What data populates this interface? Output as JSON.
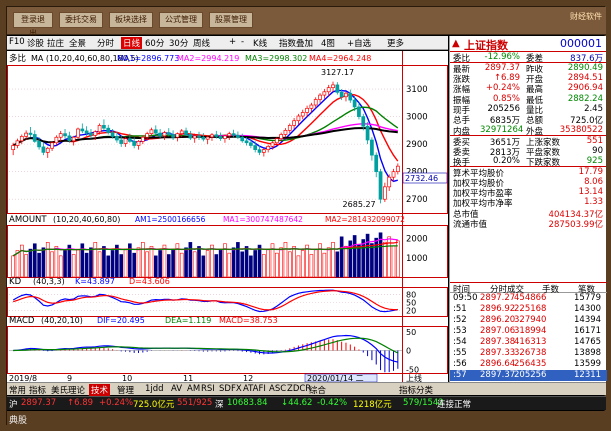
{
  "toolbar": {
    "buttons": [
      "登录退出",
      "委托交易",
      "板块选择",
      "公式管理",
      "股票管理"
    ],
    "brand": "财经软件"
  },
  "chart_menu": {
    "items": [
      "F10",
      "诊股",
      "拉庄",
      "全景",
      "分时",
      "日线",
      "60分",
      "30分",
      "周线",
      "+",
      "-",
      "K线",
      "指数叠加",
      "4图",
      "+自选",
      "更多"
    ],
    "active": "日线"
  },
  "chart_data": [
    {
      "type": "candlestick",
      "name": "price",
      "header_label": "多比",
      "ma_params": "MA (10,20,40,60,80,180,5)",
      "ma_labels": [
        {
          "text": "MA1=2896.773",
          "color": "#0000ff"
        },
        {
          "text": "MA2=2994.219",
          "color": "#ff00ff"
        },
        {
          "text": "MA3=2998.302",
          "color": "#008000"
        },
        {
          "text": "MA4=2964.248",
          "color": "#ff0000"
        }
      ],
      "ylim": [
        2650,
        3180
      ],
      "y_ticks": [
        2700,
        2800,
        2900,
        3000,
        3100
      ],
      "y_tick_labels": [
        "2700",
        "2800",
        "2900",
        "3000",
        "3100"
      ],
      "high_label": "3127.17",
      "low_label": "2685.27",
      "right_marker": "2732.46",
      "ohlc": [
        [
          2880,
          2905,
          2860,
          2895
        ],
        [
          2895,
          2920,
          2885,
          2912
        ],
        [
          2912,
          2935,
          2900,
          2928
        ],
        [
          2928,
          2950,
          2915,
          2940
        ],
        [
          2940,
          2962,
          2925,
          2935
        ],
        [
          2935,
          2950,
          2905,
          2910
        ],
        [
          2910,
          2925,
          2880,
          2890
        ],
        [
          2890,
          2905,
          2860,
          2870
        ],
        [
          2870,
          2890,
          2850,
          2885
        ],
        [
          2885,
          2910,
          2875,
          2905
        ],
        [
          2905,
          2932,
          2895,
          2925
        ],
        [
          2925,
          2948,
          2910,
          2938
        ],
        [
          2938,
          2955,
          2920,
          2930
        ],
        [
          2930,
          2945,
          2905,
          2912
        ],
        [
          2912,
          2930,
          2895,
          2925
        ],
        [
          2925,
          2960,
          2920,
          2955
        ],
        [
          2955,
          2975,
          2940,
          2948
        ],
        [
          2948,
          2965,
          2930,
          2940
        ],
        [
          2940,
          2955,
          2920,
          2932
        ],
        [
          2932,
          2950,
          2915,
          2945
        ],
        [
          2945,
          2975,
          2935,
          2968
        ],
        [
          2968,
          2990,
          2950,
          2958
        ],
        [
          2958,
          2970,
          2935,
          2942
        ],
        [
          2942,
          2955,
          2920,
          2928
        ],
        [
          2928,
          2945,
          2905,
          2915
        ],
        [
          2915,
          2930,
          2890,
          2902
        ],
        [
          2902,
          2925,
          2890,
          2920
        ],
        [
          2920,
          2938,
          2905,
          2910
        ],
        [
          2910,
          2925,
          2885,
          2895
        ],
        [
          2895,
          2915,
          2880,
          2910
        ],
        [
          2910,
          2932,
          2900,
          2925
        ],
        [
          2925,
          2945,
          2915,
          2938
        ],
        [
          2938,
          2960,
          2930,
          2952
        ],
        [
          2952,
          2968,
          2935,
          2940
        ],
        [
          2940,
          2955,
          2920,
          2930
        ],
        [
          2930,
          2948,
          2915,
          2942
        ],
        [
          2942,
          2958,
          2928,
          2935
        ],
        [
          2935,
          2950,
          2915,
          2925
        ],
        [
          2925,
          2942,
          2910,
          2938
        ],
        [
          2938,
          2955,
          2925,
          2948
        ],
        [
          2948,
          2960,
          2930,
          2935
        ],
        [
          2935,
          2948,
          2915,
          2922
        ],
        [
          2922,
          2938,
          2905,
          2930
        ],
        [
          2930,
          2945,
          2915,
          2925
        ],
        [
          2925,
          2940,
          2910,
          2918
        ],
        [
          2918,
          2932,
          2900,
          2926
        ],
        [
          2926,
          2940,
          2912,
          2934
        ],
        [
          2934,
          2948,
          2920,
          2928
        ],
        [
          2928,
          2942,
          2912,
          2920
        ],
        [
          2920,
          2935,
          2905,
          2930
        ],
        [
          2930,
          2945,
          2915,
          2938
        ],
        [
          2938,
          2952,
          2925,
          2932
        ],
        [
          2932,
          2946,
          2918,
          2925
        ],
        [
          2925,
          2938,
          2905,
          2912
        ],
        [
          2912,
          2925,
          2895,
          2905
        ],
        [
          2905,
          2918,
          2885,
          2895
        ],
        [
          2895,
          2910,
          2870,
          2880
        ],
        [
          2880,
          2895,
          2860,
          2870
        ],
        [
          2870,
          2885,
          2855,
          2880
        ],
        [
          2880,
          2898,
          2870,
          2892
        ],
        [
          2892,
          2910,
          2880,
          2905
        ],
        [
          2905,
          2925,
          2895,
          2920
        ],
        [
          2920,
          2942,
          2910,
          2935
        ],
        [
          2935,
          2958,
          2925,
          2950
        ],
        [
          2950,
          2975,
          2940,
          2968
        ],
        [
          2968,
          2995,
          2955,
          2985
        ],
        [
          2985,
          3010,
          2970,
          3002
        ],
        [
          3002,
          3025,
          2990,
          3015
        ],
        [
          3015,
          3040,
          3000,
          3030
        ],
        [
          3030,
          3050,
          3015,
          3042
        ],
        [
          3042,
          3070,
          3030,
          3062
        ],
        [
          3062,
          3085,
          3050,
          3078
        ],
        [
          3078,
          3100,
          3065,
          3090
        ],
        [
          3090,
          3115,
          3075,
          3105
        ],
        [
          3105,
          3127,
          3090,
          3115
        ],
        [
          3115,
          3125,
          3080,
          3088
        ],
        [
          3088,
          3100,
          3060,
          3072
        ],
        [
          3072,
          3090,
          3055,
          3085
        ],
        [
          3085,
          3098,
          3050,
          3060
        ],
        [
          3060,
          3075,
          3020,
          3035
        ],
        [
          3035,
          3050,
          2990,
          3000
        ],
        [
          3000,
          3010,
          2950,
          2965
        ],
        [
          2965,
          2980,
          2900,
          2915
        ],
        [
          2915,
          2925,
          2840,
          2860
        ],
        [
          2860,
          2870,
          2780,
          2800
        ],
        [
          2800,
          2810,
          2685,
          2700
        ],
        [
          2700,
          2760,
          2690,
          2745
        ],
        [
          2745,
          2790,
          2730,
          2780
        ],
        [
          2780,
          2810,
          2765,
          2800
        ],
        [
          2800,
          2830,
          2790,
          2820
        ]
      ]
    },
    {
      "type": "bar",
      "name": "volume",
      "header_label": "AMOUNT",
      "params": "(10,20,40,60,80)",
      "labels": [
        {
          "text": "AM1=2500166656",
          "color": "#0000ff"
        },
        {
          "text": "MA1=300747487642",
          "color": "#ff00ff"
        },
        {
          "text": "MA2=281432099072",
          "color": "#ff0000"
        }
      ],
      "y_ticks": [
        1000,
        2000
      ],
      "y_tick_labels": [
        "1000",
        "2000"
      ],
      "ylim": [
        0,
        2600
      ]
    },
    {
      "type": "line",
      "name": "kd",
      "header_label": "KD",
      "params": "(40,3,3)",
      "labels": [
        {
          "text": "K=43.897",
          "color": "#0000ff"
        },
        {
          "text": "D=43.606",
          "color": "#ff0000"
        }
      ],
      "ylim": [
        0,
        100
      ],
      "y_ticks": [
        20,
        50,
        80
      ],
      "y_tick_labels": [
        "20",
        "50",
        "80"
      ]
    },
    {
      "type": "line",
      "name": "macd",
      "header_label": "MACD",
      "params": "(40,20,10)",
      "labels": [
        {
          "text": "DIF=20.495",
          "color": "#0000ff"
        },
        {
          "text": "DEA=1.119",
          "color": "#008000"
        },
        {
          "text": "MACD=38.753",
          "color": "#ff0000"
        }
      ],
      "ylim": [
        -60,
        60
      ],
      "y_ticks": [
        -50,
        0,
        50
      ],
      "y_tick_labels": [
        "-50",
        "0",
        "50"
      ]
    }
  ],
  "time_axis": {
    "labels": [
      "2019/8",
      "9",
      "10",
      "11",
      "12",
      "2020/01/14 二"
    ],
    "right_label": "上线"
  },
  "quote": {
    "title": "上证指数",
    "code": "000001",
    "row_top": {
      "l": "委比",
      "v": "-12.96%",
      "l2": "委差",
      "v2": "837.6万"
    },
    "rows": [
      {
        "l": "最新",
        "v": "2897.37",
        "vc": "red",
        "l2": "昨收",
        "v2": "2890.49",
        "v2c": "green"
      },
      {
        "l": "涨跌",
        "v": "↑6.89",
        "vc": "red",
        "l2": "开盘",
        "v2": "2894.51",
        "v2c": "red"
      },
      {
        "l": "涨幅",
        "v": "+0.24%",
        "vc": "red",
        "l2": "最高",
        "v2": "2906.94",
        "v2c": "red"
      },
      {
        "l": "振幅",
        "v": "0.85%",
        "vc": "red",
        "l2": "最低",
        "v2": "2882.24",
        "v2c": "green"
      },
      {
        "l": "现手",
        "v": "205256",
        "vc": "",
        "l2": "量比",
        "v2": "2.45",
        "v2c": ""
      },
      {
        "l": "总手",
        "v": "6835万",
        "vc": "",
        "l2": "总额",
        "v2": "725.0亿",
        "v2c": ""
      },
      {
        "l": "内盘",
        "v": "32971264",
        "vc": "green",
        "l2": "外盘",
        "v2": "35380522",
        "v2c": "red"
      }
    ],
    "rows2": [
      {
        "l": "委买",
        "v": "3651万",
        "vc": "",
        "l2": "上涨家数",
        "v2": "551",
        "v2c": "red"
      },
      {
        "l": "委卖",
        "v": "2813万",
        "vc": "",
        "l2": "平盘家数",
        "v2": "90",
        "v2c": ""
      },
      {
        "l": "换手",
        "v": "0.20%",
        "vc": "",
        "l2": "下跌家数",
        "v2": "925",
        "v2c": "green"
      }
    ],
    "stats": [
      {
        "l": "算术平均股价",
        "v": "17.79"
      },
      {
        "l": "加权平均股价",
        "v": "8.06"
      },
      {
        "l": "加权平均市盈率",
        "v": "13.14"
      },
      {
        "l": "加权平均市净率",
        "v": "1.33"
      },
      {
        "l": "总市值",
        "v": "404134.37亿"
      },
      {
        "l": "流通市值",
        "v": "287503.99亿"
      }
    ]
  },
  "ticks": {
    "headers": [
      "时间",
      "分时成交",
      "手数",
      "笔数"
    ],
    "rows": [
      {
        "t": "09:50",
        "p": "2897.27",
        "q": "454866",
        "n": "15779"
      },
      {
        "t": ":51",
        "p": "2896.92",
        "q": "225168",
        "n": "14300"
      },
      {
        "t": ":52",
        "p": "2896.20",
        "q": "327940",
        "n": "14394"
      },
      {
        "t": ":53",
        "p": "2897.06",
        "q": "318994",
        "n": "16171"
      },
      {
        "t": ":54",
        "p": "2897.38",
        "q": "416313",
        "n": "14765"
      },
      {
        "t": ":55",
        "p": "2897.33",
        "q": "326738",
        "n": "13898"
      },
      {
        "t": ":56",
        "p": "2896.64",
        "q": "256435",
        "n": "13599"
      },
      {
        "t": ":57",
        "p": "2897.37",
        "q": "205256",
        "n": "12311"
      }
    ]
  },
  "bottom_tabs": {
    "items": [
      "常用",
      "指标",
      "美氏理论",
      "技术",
      "管理",
      "1jdd",
      "AV",
      "AM",
      "RSI",
      "SDFX",
      "ATAFI",
      "ASC",
      "ZDCR",
      "综合"
    ],
    "selected": "技术",
    "right": "指标分类"
  },
  "status": {
    "items": [
      {
        "text": "沪",
        "c": "#fff"
      },
      {
        "text": "2897.37",
        "c": "#f33"
      },
      {
        "text": "↑6.89",
        "c": "#f33"
      },
      {
        "text": "+0.24%",
        "c": "#f33"
      },
      {
        "text": "725.0亿元",
        "c": "#ff0"
      },
      {
        "text": "551/925",
        "c": "#f33"
      },
      {
        "text": "深",
        "c": "#fff"
      },
      {
        "text": "10683.84",
        "c": "#3f3"
      },
      {
        "text": "↓44.62",
        "c": "#3f3"
      },
      {
        "text": "-0.42%",
        "c": "#3f3"
      },
      {
        "text": "1218亿元",
        "c": "#ff0"
      },
      {
        "text": "579/1542",
        "c": "#3f3"
      },
      {
        "text": "连接正常",
        "c": "#fff"
      }
    ]
  },
  "footer": {
    "text": "典股"
  }
}
